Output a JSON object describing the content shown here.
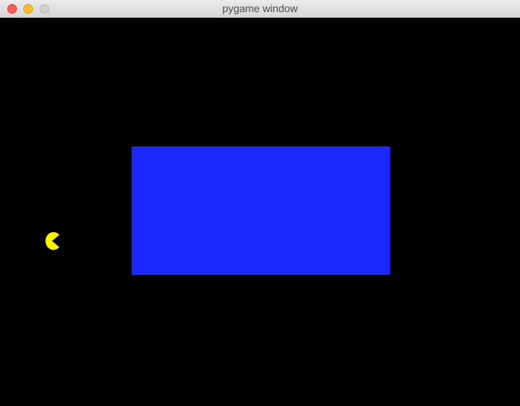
{
  "window": {
    "title": "pygame window",
    "buttons": {
      "close_color": "#fe5f57",
      "minimize_color": "#febc2e",
      "zoom_color": "#d0d0d0"
    }
  },
  "game": {
    "background_color": "#000000",
    "rectangle": {
      "fill": "#1a28ff"
    },
    "player": {
      "type": "pacman-icon",
      "color": "#ffee00",
      "facing": "left"
    }
  }
}
